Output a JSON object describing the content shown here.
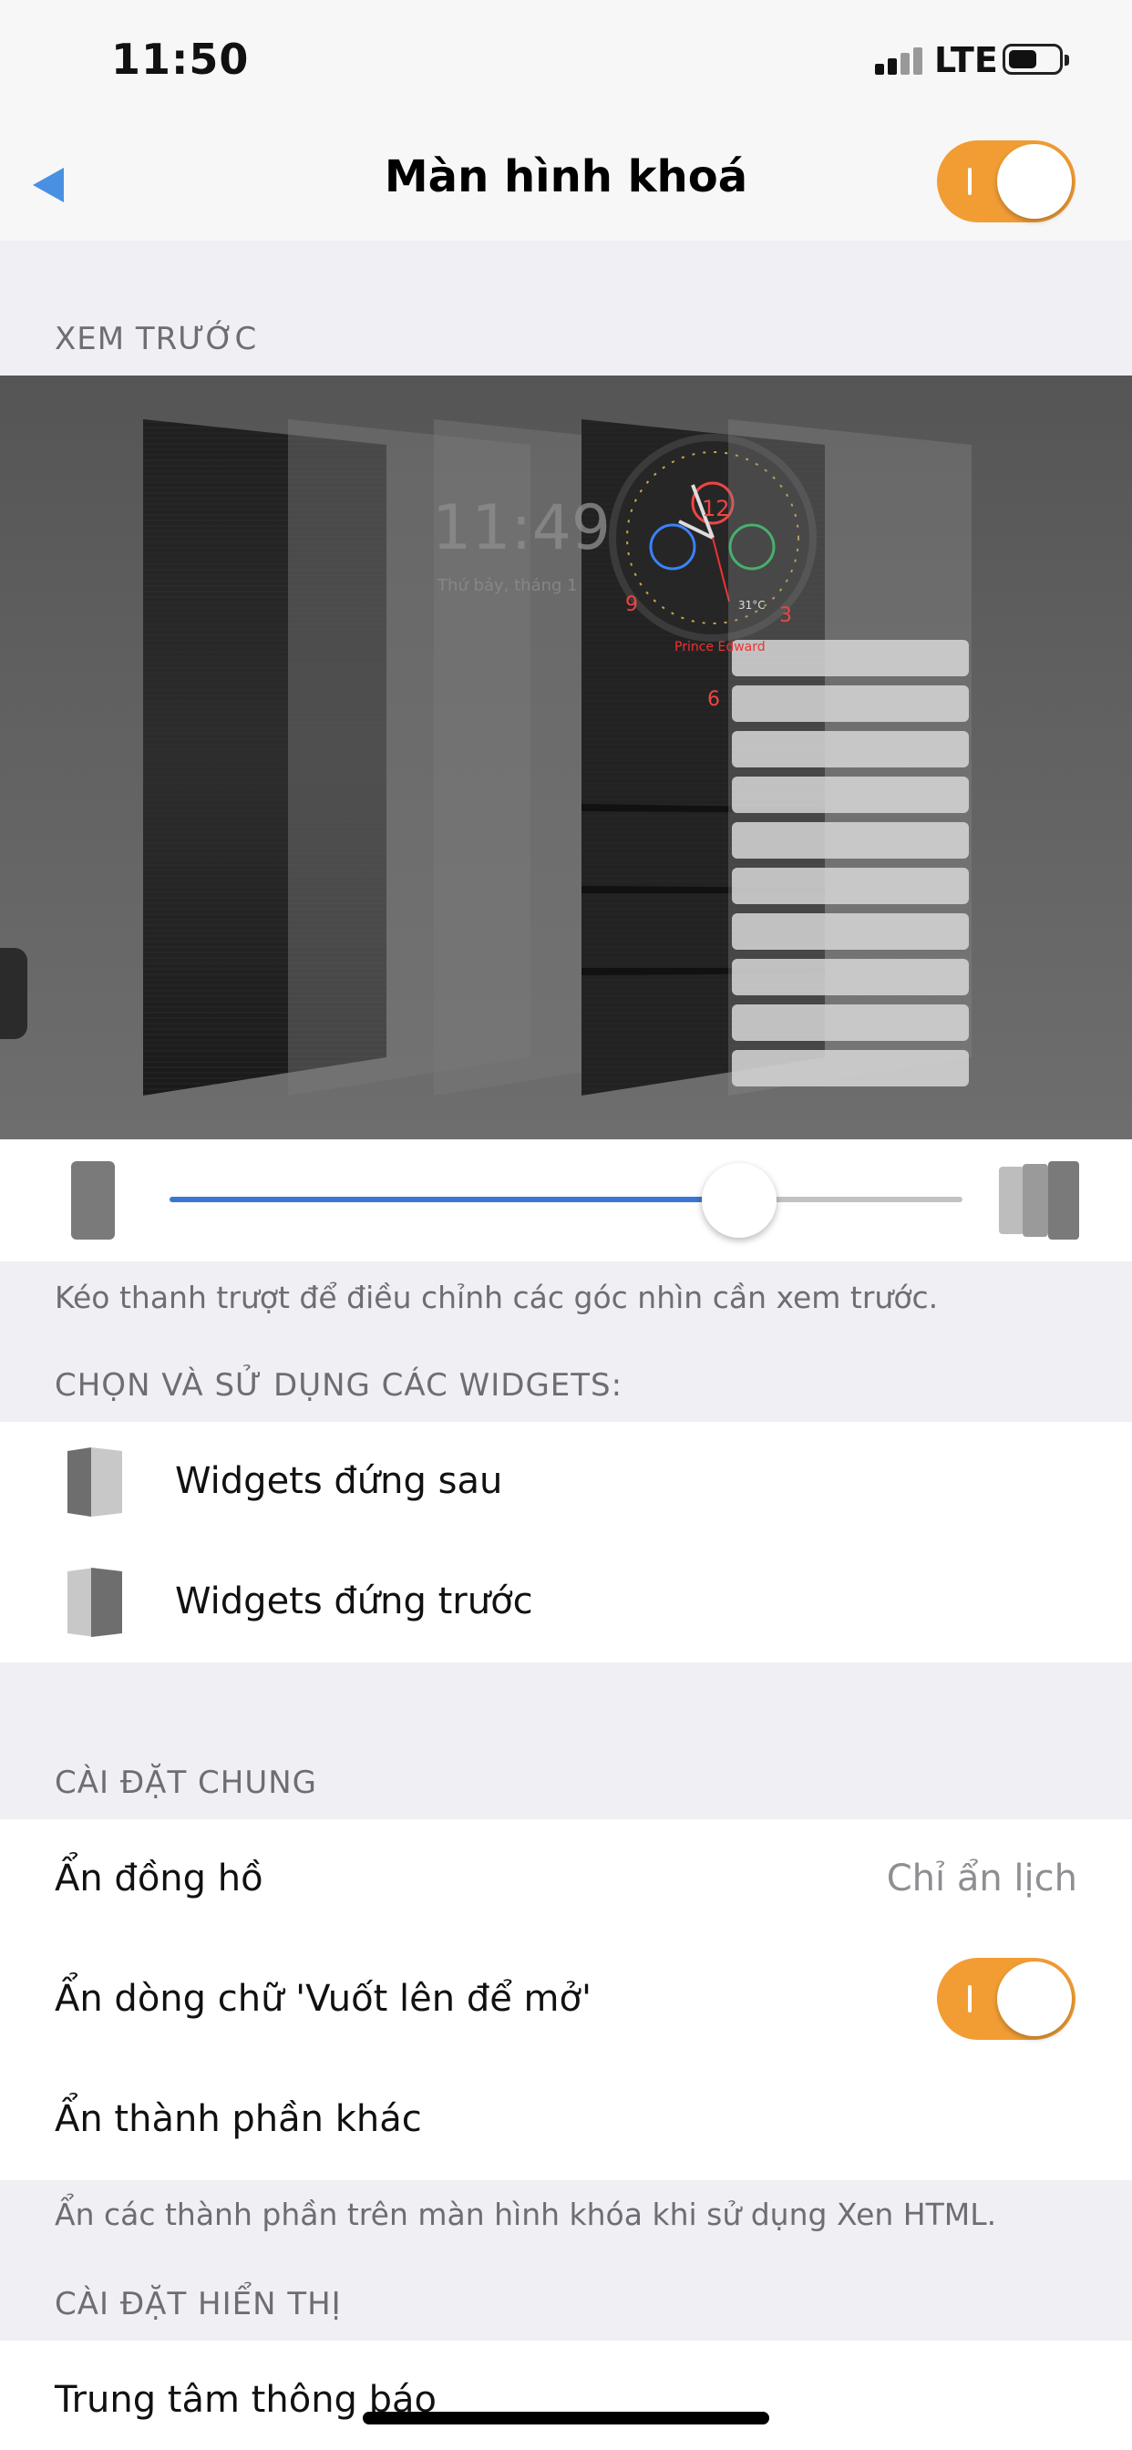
{
  "status_bar": {
    "time": "11:50",
    "network": "LTE"
  },
  "nav": {
    "title": "Màn hình khoá",
    "enabled": true
  },
  "preview": {
    "header": "XEM TRƯỚC",
    "sample_time": "11:49",
    "sample_date": "Thứ bảy, tháng 1",
    "clock_numbers": [
      "12",
      "3",
      "6",
      "9"
    ],
    "clock_temp": "31°C",
    "clock_name": "Prince Edward"
  },
  "slider": {
    "value": 0.67
  },
  "slider_footnote": "Kéo thanh trượt để điều chỉnh các góc nhìn cần xem trước.",
  "widgets": {
    "header": "CHỌN VÀ SỬ DỤNG CÁC WIDGETS:",
    "items": [
      {
        "label": "Widgets đứng sau",
        "icon": "layers-back-icon"
      },
      {
        "label": "Widgets đứng trước",
        "icon": "layers-front-icon"
      }
    ]
  },
  "general": {
    "header": "CÀI ĐẶT CHUNG",
    "hide_clock": {
      "label": "Ẩn đồng hồ",
      "value": "Chỉ ẩn lịch"
    },
    "hide_swipe": {
      "label": "Ẩn dòng chữ 'Vuốt lên để mở'",
      "enabled": true
    },
    "hide_other": {
      "label": "Ẩn thành phần khác"
    },
    "footnote": "Ẩn các thành phần trên màn hình khóa khi sử dụng Xen HTML."
  },
  "display": {
    "header": "CÀI ĐẶT HIỂN THỊ",
    "notification_center": {
      "label": "Trung tâm thông báo"
    }
  },
  "colors": {
    "accent": "#f19d34",
    "slider": "#3b76d4",
    "back": "#4a90e2"
  }
}
